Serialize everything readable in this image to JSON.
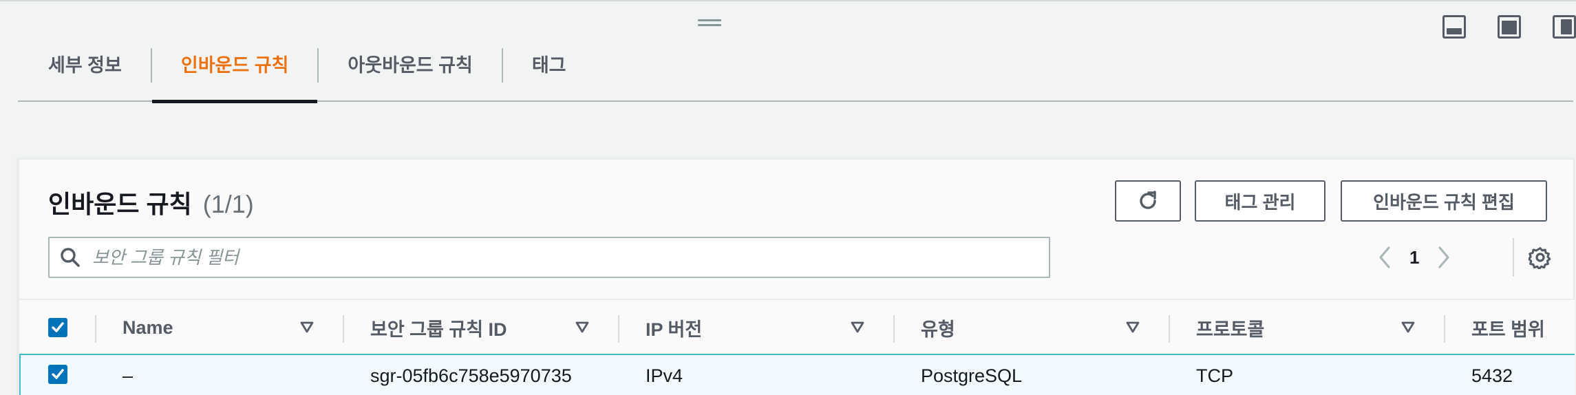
{
  "tabs": [
    {
      "label": "세부 정보",
      "active": false
    },
    {
      "label": "인바운드 규칙",
      "active": true
    },
    {
      "label": "아웃바운드 규칙",
      "active": false
    },
    {
      "label": "태그",
      "active": false
    }
  ],
  "panel": {
    "title": "인바운드 규칙",
    "count": "(1/1)",
    "buttons": {
      "refresh_icon": "refresh-icon",
      "manage_tags": "태그 관리",
      "edit_rules": "인바운드 규칙 편집"
    },
    "search": {
      "placeholder": "보안 그룹 규칙 필터",
      "value": ""
    },
    "pagination": {
      "current_page": "1"
    }
  },
  "table": {
    "columns": [
      "Name",
      "보안 그룹 규칙 ID",
      "IP 버전",
      "유형",
      "프로토콜",
      "포트 범위"
    ],
    "rows": [
      {
        "selected": true,
        "name": "–",
        "rule_id": "sgr-05fb6c758e5970735",
        "ip_version": "IPv4",
        "type": "PostgreSQL",
        "protocol": "TCP",
        "port_range": "5432"
      }
    ],
    "select_all": true
  },
  "colors": {
    "accent": "#ec7211",
    "checkbox": "#0073bb",
    "selected_row_bg": "#f1faff",
    "selected_row_border": "#44b9d6"
  }
}
